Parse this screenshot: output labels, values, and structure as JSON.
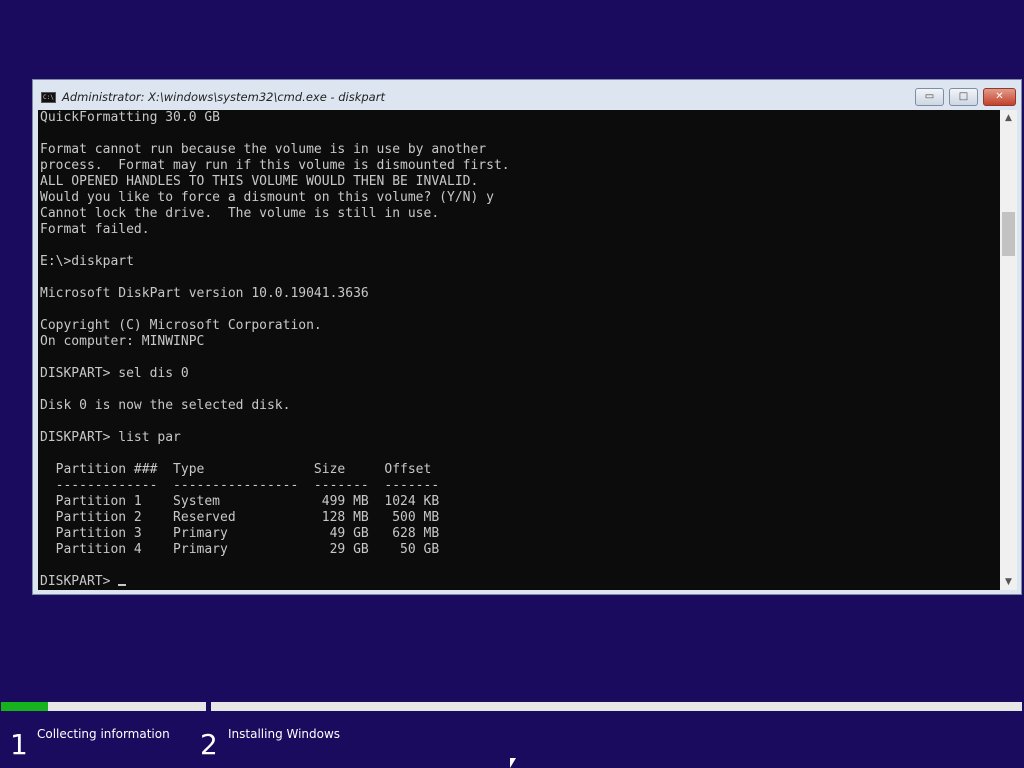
{
  "window": {
    "title": "Administrator: X:\\windows\\system32\\cmd.exe - diskpart",
    "icon": "cmd-icon",
    "minimize_glyph": "▭",
    "maximize_glyph": "□",
    "close_glyph": "✕"
  },
  "console": {
    "lines": [
      "QuickFormatting 30.0 GB",
      "",
      "Format cannot run because the volume is in use by another",
      "process.  Format may run if this volume is dismounted first.",
      "ALL OPENED HANDLES TO THIS VOLUME WOULD THEN BE INVALID.",
      "Would you like to force a dismount on this volume? (Y/N) y",
      "Cannot lock the drive.  The volume is still in use.",
      "Format failed.",
      "",
      "E:\\>diskpart",
      "",
      "Microsoft DiskPart version 10.0.19041.3636",
      "",
      "Copyright (C) Microsoft Corporation.",
      "On computer: MINWINPC",
      "",
      "DISKPART> sel dis 0",
      "",
      "Disk 0 is now the selected disk.",
      "",
      "DISKPART> list par",
      "",
      "  Partition ###  Type              Size     Offset",
      "  -------------  ----------------  -------  -------",
      "  Partition 1    System             499 MB  1024 KB",
      "  Partition 2    Reserved           128 MB   500 MB",
      "  Partition 3    Primary             49 GB   628 MB",
      "  Partition 4    Primary             29 GB    50 GB",
      ""
    ],
    "prompt": "DISKPART> "
  },
  "scrollbar": {
    "up_glyph": "▲",
    "down_glyph": "▼"
  },
  "setup": {
    "progress": 0.23,
    "steps": [
      {
        "number": "1",
        "label": "Collecting information"
      },
      {
        "number": "2",
        "label": "Installing Windows"
      }
    ],
    "progress_color": "#16b31e"
  },
  "colors": {
    "background": "#1a0b5e",
    "console_bg": "#0c0c0c",
    "console_fg": "#c8c8c8"
  }
}
